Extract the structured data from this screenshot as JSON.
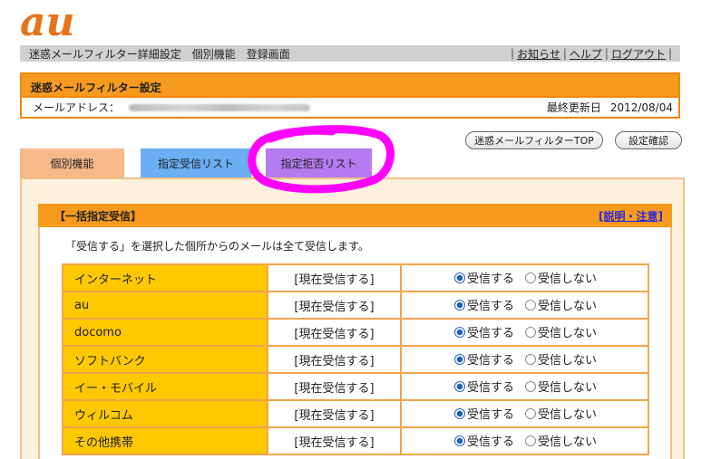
{
  "brand": {
    "logo_text": "au",
    "logo_color": "#e8741a"
  },
  "topbar": {
    "breadcrumb": "迷惑メールフィルター詳細設定　個別機能　登録画面",
    "links": [
      "お知らせ",
      "ヘルプ",
      "ログアウト"
    ]
  },
  "header": {
    "title": "迷惑メールフィルター設定",
    "address_label": "メールアドレス：",
    "updated_label": "最終更新日",
    "updated_date": "2012/08/04"
  },
  "buttons": {
    "filter_top": "迷惑メールフィルターTOP",
    "confirm": "設定確認"
  },
  "tabs": [
    {
      "label": "個別機能"
    },
    {
      "label": "指定受信リスト"
    },
    {
      "label": "指定拒否リスト"
    }
  ],
  "section": {
    "title": "【一括指定受信】",
    "help_link": "[説明・注意]",
    "description": "「受信する」を選択した個所からのメールは全て受信します。"
  },
  "option_labels": {
    "accept": "受信する",
    "reject": "受信しない"
  },
  "rows": [
    {
      "name": "インターネット",
      "status": "[現在受信する]",
      "accept": true
    },
    {
      "name": "au",
      "status": "[現在受信する]",
      "accept": true
    },
    {
      "name": "docomo",
      "status": "[現在受信する]",
      "accept": true
    },
    {
      "name": "ソフトバンク",
      "status": "[現在受信する]",
      "accept": true
    },
    {
      "name": "イー・モバイル",
      "status": "[現在受信する]",
      "accept": true
    },
    {
      "name": "ウィルコム",
      "status": "[現在受信する]",
      "accept": true
    },
    {
      "name": "その他携帯",
      "status": "[現在受信する]",
      "accept": true
    }
  ],
  "colors": {
    "orange": "#f79a1e",
    "row_name_bg": "#ffc800",
    "tab_kobetsu": "#f5b98a",
    "tab_accept": "#6aaef3",
    "tab_reject": "#b57af0",
    "highlight": "#ff00ff"
  }
}
